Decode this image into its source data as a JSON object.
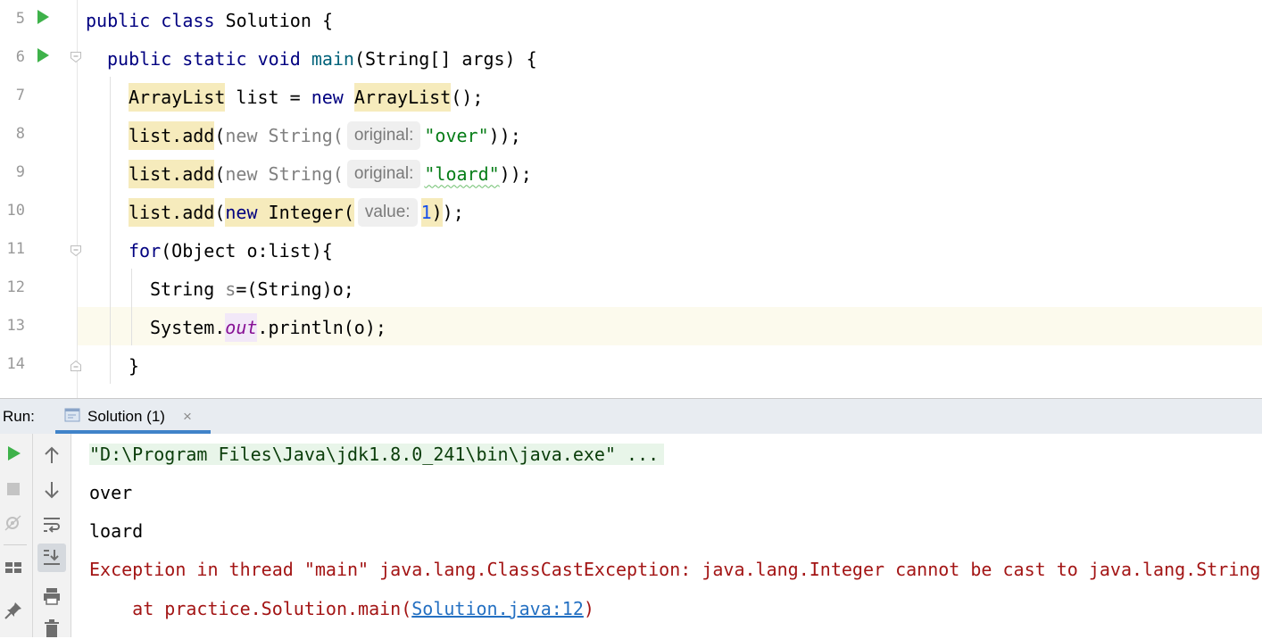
{
  "editor": {
    "line_numbers": [
      "5",
      "6",
      "7",
      "8",
      "9",
      "10",
      "11",
      "12",
      "13",
      "14"
    ],
    "lines": {
      "l5": {
        "kw1": "public",
        "kw2": "class",
        "name": "Solution",
        "brace": "{"
      },
      "l6": {
        "kw1": "public",
        "kw2": "static",
        "kw3": "void",
        "method": "main",
        "params": "(String[] args) {"
      },
      "l7": {
        "type1": "ArrayList",
        "mid": " list = ",
        "kw": "new",
        "type2": "ArrayList",
        "tail": "();"
      },
      "l8": {
        "call": "list.add",
        "open": "(",
        "kw": "new",
        "type": " String(",
        "hint": "original:",
        "str": "\"over\"",
        "tail": "));"
      },
      "l9": {
        "call": "list.add",
        "open": "(",
        "kw": "new",
        "type": " String(",
        "hint": "original:",
        "str": "\"loard\"",
        "tail": "));"
      },
      "l10": {
        "call": "list.add",
        "open": "(",
        "kw": "new",
        "type": " Integer(",
        "hint": "value:",
        "num": "1",
        "close": ")",
        "tail": ");"
      },
      "l11": {
        "kw": "for",
        "rest": "(Object o:list){"
      },
      "l12": {
        "type": "String ",
        "var": "s",
        "rest": "=(String)o;"
      },
      "l13": {
        "cls": "System.",
        "field": "out",
        "rest": ".println(o);"
      },
      "l14": {
        "brace": "}"
      }
    }
  },
  "run_window": {
    "label": "Run:",
    "tab_title": "Solution (1)",
    "tab_close": "×",
    "console": {
      "command": "\"D:\\Program Files\\Java\\jdk1.8.0_241\\bin\\java.exe\" ...",
      "out1": "over",
      "out2": "loard",
      "exception": "Exception in thread \"main\" java.lang.ClassCastException: java.lang.Integer cannot be cast to java.lang.String",
      "at_prefix": "    at practice.Solution.main(",
      "at_link": "Solution.java:12",
      "at_suffix": ")"
    }
  },
  "colors": {
    "keyword": "#000080",
    "string": "#067d17",
    "number": "#1750eb",
    "error": "#a31515",
    "link": "#2470c2",
    "run_green": "#3eb24a"
  },
  "icons": [
    "run-gutter-icon",
    "fold-icon",
    "rerun-icon",
    "stop-icon",
    "restore-layout-icon",
    "layout-icon",
    "pin-icon",
    "up-arrow-icon",
    "down-arrow-icon",
    "soft-wrap-icon",
    "scroll-to-end-icon",
    "print-icon",
    "trash-icon",
    "console-tab-icon",
    "close-icon"
  ]
}
